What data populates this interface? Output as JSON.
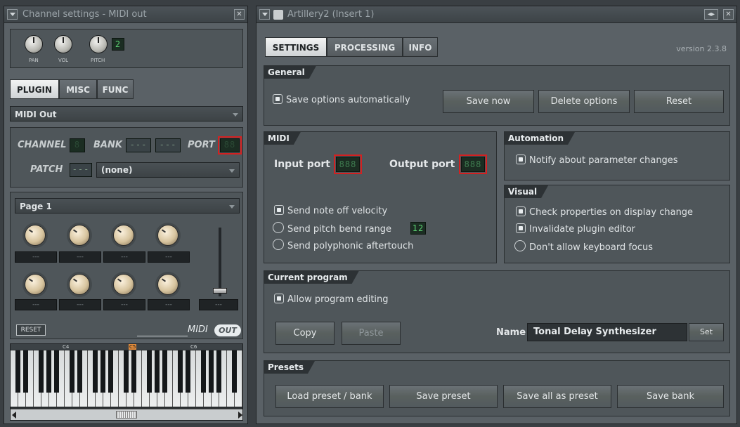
{
  "left_window": {
    "title": "Channel settings - MIDI out",
    "knob_labels": {
      "pan": "PAN",
      "vol": "VOL",
      "pitch": "PITCH"
    },
    "pitch_lcd": "2",
    "tabs": [
      "PLUGIN",
      "MISC",
      "FUNC"
    ],
    "plugin_select": "MIDI Out",
    "channel_label": "CHANNEL",
    "bank_label": "BANK",
    "port_label": "PORT",
    "patch_label": "PATCH",
    "patch_value": "(none)",
    "dashes": "---",
    "page_select": "Page 1",
    "knob_slot_value": "---",
    "reset_label": "RESET",
    "midi_logo": "MIDI",
    "out_logo": "OUT",
    "keyboard_labels": [
      "C4",
      "C5",
      "C6"
    ]
  },
  "right_window": {
    "title": "Artillery2 (Insert 1)",
    "tabs": [
      "SETTINGS",
      "PROCESSING",
      "INFO"
    ],
    "version": "version 2.3.8",
    "general": {
      "title": "General",
      "save_auto": "Save options automatically",
      "save_now": "Save now",
      "delete_options": "Delete options",
      "reset": "Reset"
    },
    "midi": {
      "title": "MIDI",
      "input_port": "Input port",
      "output_port": "Output port",
      "send_note_off": "Send note off velocity",
      "send_pitch_bend": "Send pitch bend range",
      "pitch_bend_value": "12",
      "send_poly": "Send polyphonic aftertouch"
    },
    "automation": {
      "title": "Automation",
      "notify": "Notify about parameter changes"
    },
    "visual": {
      "title": "Visual",
      "check_props": "Check properties on display change",
      "invalidate": "Invalidate plugin editor",
      "no_kb_focus": "Don't allow keyboard focus"
    },
    "current_program": {
      "title": "Current program",
      "allow_editing": "Allow program editing",
      "copy": "Copy",
      "paste": "Paste",
      "name_label": "Name",
      "name_value": "Tonal Delay Synthesizer",
      "set": "Set"
    },
    "presets": {
      "title": "Presets",
      "load": "Load preset / bank",
      "save_preset": "Save preset",
      "save_all": "Save all as preset",
      "save_bank": "Save bank"
    }
  },
  "colors": {
    "lcd_green": "#5bd071",
    "highlight_red": "#d42020"
  }
}
